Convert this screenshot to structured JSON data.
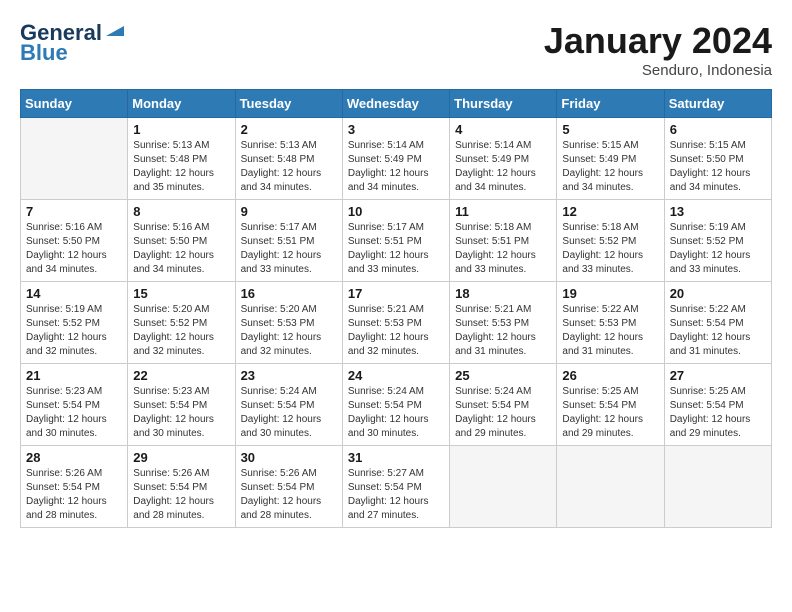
{
  "header": {
    "logo_line1": "General",
    "logo_line2": "Blue",
    "month": "January 2024",
    "location": "Senduro, Indonesia"
  },
  "days_of_week": [
    "Sunday",
    "Monday",
    "Tuesday",
    "Wednesday",
    "Thursday",
    "Friday",
    "Saturday"
  ],
  "weeks": [
    [
      {
        "day": "",
        "info": ""
      },
      {
        "day": "1",
        "info": "Sunrise: 5:13 AM\nSunset: 5:48 PM\nDaylight: 12 hours\nand 35 minutes."
      },
      {
        "day": "2",
        "info": "Sunrise: 5:13 AM\nSunset: 5:48 PM\nDaylight: 12 hours\nand 34 minutes."
      },
      {
        "day": "3",
        "info": "Sunrise: 5:14 AM\nSunset: 5:49 PM\nDaylight: 12 hours\nand 34 minutes."
      },
      {
        "day": "4",
        "info": "Sunrise: 5:14 AM\nSunset: 5:49 PM\nDaylight: 12 hours\nand 34 minutes."
      },
      {
        "day": "5",
        "info": "Sunrise: 5:15 AM\nSunset: 5:49 PM\nDaylight: 12 hours\nand 34 minutes."
      },
      {
        "day": "6",
        "info": "Sunrise: 5:15 AM\nSunset: 5:50 PM\nDaylight: 12 hours\nand 34 minutes."
      }
    ],
    [
      {
        "day": "7",
        "info": ""
      },
      {
        "day": "8",
        "info": "Sunrise: 5:16 AM\nSunset: 5:50 PM\nDaylight: 12 hours\nand 34 minutes."
      },
      {
        "day": "9",
        "info": "Sunrise: 5:17 AM\nSunset: 5:51 PM\nDaylight: 12 hours\nand 33 minutes."
      },
      {
        "day": "10",
        "info": "Sunrise: 5:17 AM\nSunset: 5:51 PM\nDaylight: 12 hours\nand 33 minutes."
      },
      {
        "day": "11",
        "info": "Sunrise: 5:18 AM\nSunset: 5:51 PM\nDaylight: 12 hours\nand 33 minutes."
      },
      {
        "day": "12",
        "info": "Sunrise: 5:18 AM\nSunset: 5:52 PM\nDaylight: 12 hours\nand 33 minutes."
      },
      {
        "day": "13",
        "info": "Sunrise: 5:19 AM\nSunset: 5:52 PM\nDaylight: 12 hours\nand 33 minutes."
      }
    ],
    [
      {
        "day": "14",
        "info": ""
      },
      {
        "day": "15",
        "info": "Sunrise: 5:20 AM\nSunset: 5:52 PM\nDaylight: 12 hours\nand 32 minutes."
      },
      {
        "day": "16",
        "info": "Sunrise: 5:20 AM\nSunset: 5:53 PM\nDaylight: 12 hours\nand 32 minutes."
      },
      {
        "day": "17",
        "info": "Sunrise: 5:21 AM\nSunset: 5:53 PM\nDaylight: 12 hours\nand 32 minutes."
      },
      {
        "day": "18",
        "info": "Sunrise: 5:21 AM\nSunset: 5:53 PM\nDaylight: 12 hours\nand 31 minutes."
      },
      {
        "day": "19",
        "info": "Sunrise: 5:22 AM\nSunset: 5:53 PM\nDaylight: 12 hours\nand 31 minutes."
      },
      {
        "day": "20",
        "info": "Sunrise: 5:22 AM\nSunset: 5:54 PM\nDaylight: 12 hours\nand 31 minutes."
      }
    ],
    [
      {
        "day": "21",
        "info": ""
      },
      {
        "day": "22",
        "info": "Sunrise: 5:23 AM\nSunset: 5:54 PM\nDaylight: 12 hours\nand 30 minutes."
      },
      {
        "day": "23",
        "info": "Sunrise: 5:24 AM\nSunset: 5:54 PM\nDaylight: 12 hours\nand 30 minutes."
      },
      {
        "day": "24",
        "info": "Sunrise: 5:24 AM\nSunset: 5:54 PM\nDaylight: 12 hours\nand 30 minutes."
      },
      {
        "day": "25",
        "info": "Sunrise: 5:24 AM\nSunset: 5:54 PM\nDaylight: 12 hours\nand 29 minutes."
      },
      {
        "day": "26",
        "info": "Sunrise: 5:25 AM\nSunset: 5:54 PM\nDaylight: 12 hours\nand 29 minutes."
      },
      {
        "day": "27",
        "info": "Sunrise: 5:25 AM\nSunset: 5:54 PM\nDaylight: 12 hours\nand 29 minutes."
      }
    ],
    [
      {
        "day": "28",
        "info": ""
      },
      {
        "day": "29",
        "info": "Sunrise: 5:26 AM\nSunset: 5:54 PM\nDaylight: 12 hours\nand 28 minutes."
      },
      {
        "day": "30",
        "info": "Sunrise: 5:26 AM\nSunset: 5:54 PM\nDaylight: 12 hours\nand 28 minutes."
      },
      {
        "day": "31",
        "info": "Sunrise: 5:27 AM\nSunset: 5:54 PM\nDaylight: 12 hours\nand 27 minutes."
      },
      {
        "day": "",
        "info": ""
      },
      {
        "day": "",
        "info": ""
      },
      {
        "day": "",
        "info": ""
      }
    ]
  ],
  "week1_sun_info": "Sunrise: 5:16 AM\nSunset: 5:50 PM\nDaylight: 12 hours\nand 34 minutes.",
  "week3_sun_info": "Sunrise: 5:19 AM\nSunset: 5:52 PM\nDaylight: 12 hours\nand 32 minutes.",
  "week4_sun_info": "Sunrise: 5:23 AM\nSunset: 5:54 PM\nDaylight: 12 hours\nand 30 minutes.",
  "week5_sun_info": "Sunrise: 5:26 AM\nSunset: 5:54 PM\nDaylight: 12 hours\nand 28 minutes."
}
